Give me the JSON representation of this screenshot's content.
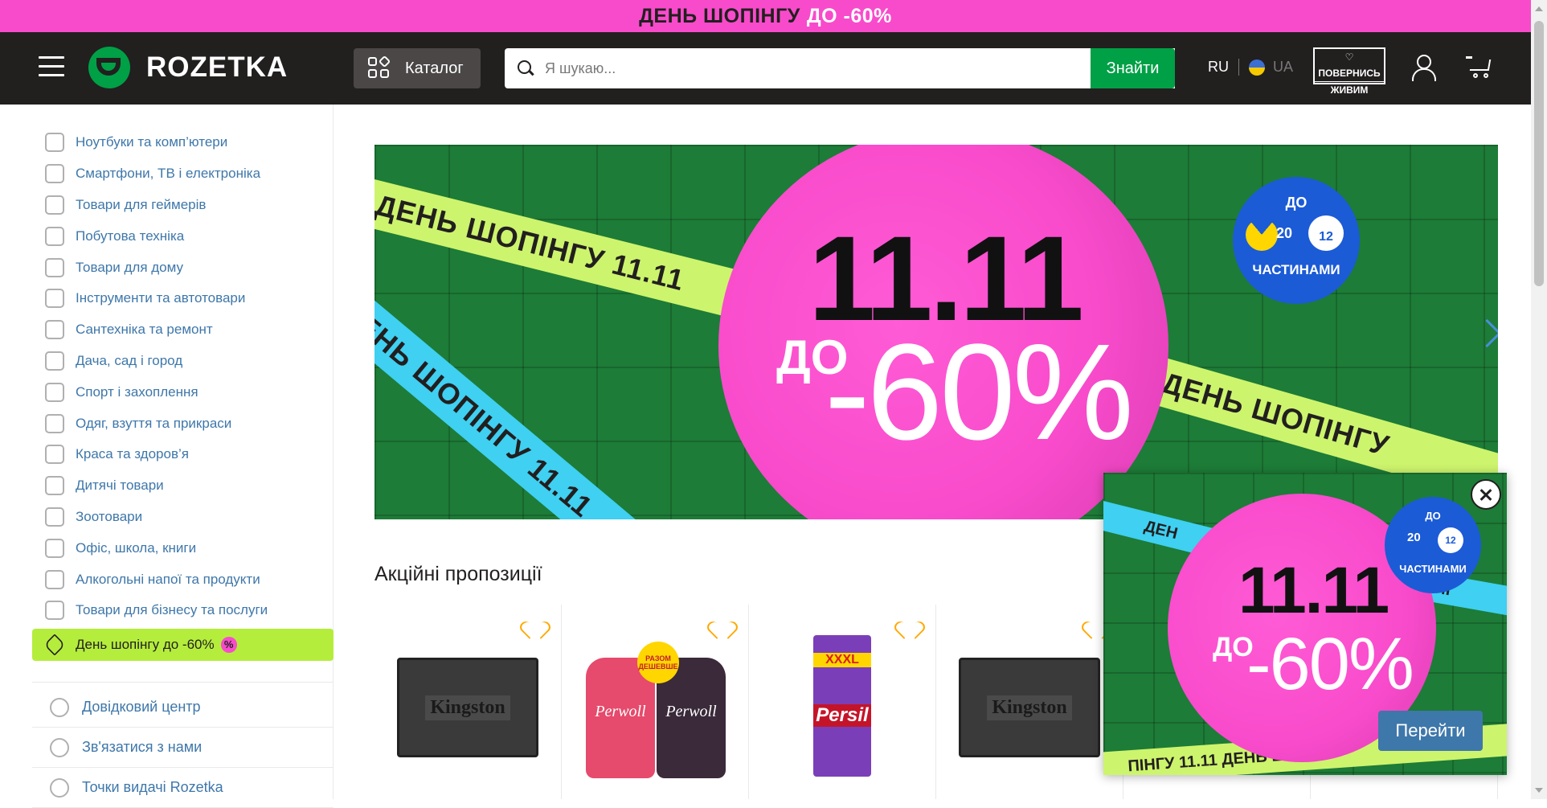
{
  "promo_strip": {
    "text": "ДЕНЬ ШОПІНГУ",
    "highlight": "ДО -60%"
  },
  "header": {
    "logo_text": "ROZETKA",
    "catalog_label": "Каталог",
    "search": {
      "placeholder": "Я шукаю...",
      "button_label": "Знайти"
    },
    "lang": {
      "ru": "RU",
      "ua": "UA"
    },
    "povernys": {
      "line1": "♡ ПОВЕРНИСЬ",
      "line2": "ЖИВИМ"
    }
  },
  "sidebar": {
    "items": [
      {
        "label": "Ноутбуки та комп’ютери",
        "icon": "laptop-icon"
      },
      {
        "label": "Смартфони, ТВ і електроніка",
        "icon": "smartphone-icon"
      },
      {
        "label": "Товари для геймерів",
        "icon": "gamepad-icon"
      },
      {
        "label": "Побутова техніка",
        "icon": "washing-machine-icon"
      },
      {
        "label": "Товари для дому",
        "icon": "armchair-icon"
      },
      {
        "label": "Інструменти та автотовари",
        "icon": "drill-icon"
      },
      {
        "label": "Сантехніка та ремонт",
        "icon": "bathtub-icon"
      },
      {
        "label": "Дача, сад і город",
        "icon": "garden-tools-icon"
      },
      {
        "label": "Спорт і захоплення",
        "icon": "racket-icon"
      },
      {
        "label": "Одяг, взуття та прикраси",
        "icon": "tshirt-icon"
      },
      {
        "label": "Краса та здоров’я",
        "icon": "perfume-icon"
      },
      {
        "label": "Дитячі товари",
        "icon": "teddy-bear-icon"
      },
      {
        "label": "Зоотовари",
        "icon": "paw-icon"
      },
      {
        "label": "Офіс, школа, книги",
        "icon": "paperclip-icon"
      },
      {
        "label": "Алкогольні напої та продукти",
        "icon": "cocktail-icon"
      },
      {
        "label": "Товари для бізнесу та послуги",
        "icon": "barcode-icon"
      }
    ],
    "active": {
      "label": "День шопінгу до -60%",
      "badge": "%",
      "icon": "tag-icon"
    },
    "extra": [
      {
        "label": "Довідковий центр",
        "icon": "help-icon"
      },
      {
        "label": "Зв'язатися з нами",
        "icon": "paper-plane-icon"
      },
      {
        "label": "Точки видачі Rozetka",
        "icon": "store-icon"
      }
    ]
  },
  "banner": {
    "ribbon_text": "ДЕНЬ ШОПІНГУ 11.11",
    "ribbon_text_short": "ДЕНЬ ШОПІНГУ",
    "date": "11.11",
    "do": "ДО",
    "discount": "-60%",
    "badge_top": "ДО",
    "badge_20": "20",
    "badge_12": "12",
    "badge_bottom": "ЧАСТИНАМИ"
  },
  "section_title": "Акційні пропозиції",
  "products": [
    {
      "image_text": "Kingston"
    },
    {
      "image_text_left": "Perwoll",
      "image_text_right": "Perwoll",
      "badge": "РАЗОМ ДЕШЕВШЕ"
    },
    {
      "image_text_top": "XXXL",
      "image_text": "Persil"
    },
    {
      "image_text": "Kingston"
    }
  ],
  "popup": {
    "ribbon_left": "ДЕН",
    "ribbon_right": "ШОПІ",
    "ribbon_bottom": "ПІНГУ 11.11          ДЕНЬ ШОПІН",
    "date": "11.11",
    "do": "ДО",
    "discount": "-60%",
    "badge_top": "ДО",
    "badge_20": "20",
    "badge_12": "12",
    "badge_bottom": "ЧАСТИНАМИ",
    "go_label": "Перейти"
  },
  "colors": {
    "accent_pink": "#f84bcb",
    "green": "#00a046",
    "header_bg": "#221f1f",
    "link_blue": "#3e77aa",
    "lime": "#b5ed3d"
  }
}
